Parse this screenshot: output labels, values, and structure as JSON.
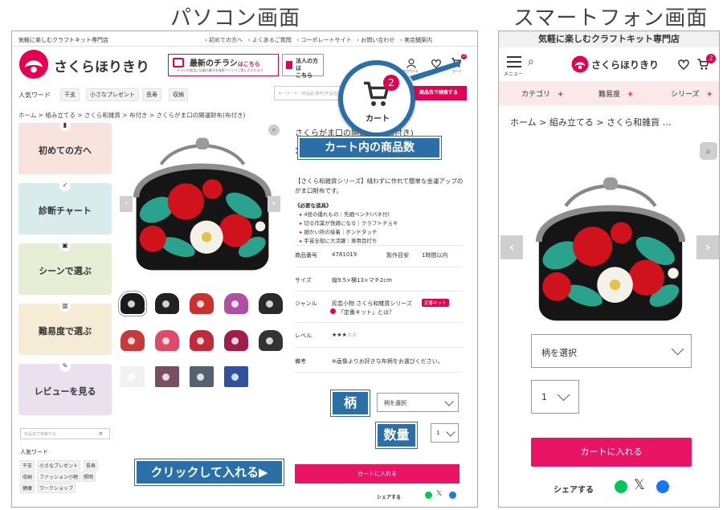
{
  "titles": {
    "pc": "パソコン画面",
    "sp": "スマートフォン画面"
  },
  "pc": {
    "topbar": {
      "tagline": "気軽に楽しむクラフトキット専門店",
      "links": [
        "初めての方へ",
        "よくあるご質問",
        "コーポレートサイト",
        "お問い合わせ",
        "実店舗案内"
      ]
    },
    "logo_text": "さくらほりきり",
    "flyer": {
      "title": "最新のチラシ",
      "suffix": "はこちら",
      "sub": "チラシの商品に記載の番号を検索ページでご覧いただけます"
    },
    "corp": {
      "line1": "法人の方は",
      "line2": "こちら"
    },
    "header_icons": {
      "account_label": "アカウント",
      "cart_label": "カート",
      "cart_count": "2"
    },
    "popular": {
      "label": "人気ワード",
      "tags": [
        "干支",
        "小さなプレゼント",
        "長寿",
        "収納"
      ]
    },
    "search": {
      "placeholder": "キーワード（商品名/番号/作品名）",
      "button": "商品名で検索する"
    },
    "breadcrumb": [
      "ホーム",
      "組み立てる",
      "さくら和雑貨",
      "布付き",
      "さくらがま口の開運財布(布付き)"
    ],
    "sidebar": [
      "初めての方へ",
      "診断チャート",
      "シーンで選ぶ",
      "難易度で選ぶ",
      "レビューを見る"
    ],
    "side_search_placeholder": "商品名で検索する",
    "side_popular": {
      "label": "人気ワード",
      "tags": [
        "干支",
        "小さなプレゼント",
        "長寿",
        "収納",
        "ファッション小物",
        "照明",
        "健康",
        "ワークショップ"
      ]
    },
    "product": {
      "name": "さくらがま口の開運財布(布付き)",
      "desc1": "【さくら和雑貨シリーズ】縫わずに作れて簡単な金運アップの",
      "desc2": "がま口財布です。",
      "tools_title": "《必要な道具》",
      "tools": [
        "4役の優れもの｜先細ペンチ(バネ付)",
        "切る作業が快適になる｜クラフトチョキ",
        "細かい所の接着｜ボンドタッチ",
        "手芸全般に大活躍｜専用目打ち"
      ],
      "rows": [
        {
          "k": "商品番号",
          "v": "4781019",
          "k2": "製作目安",
          "v2": "1時間以内"
        },
        {
          "k": "サイズ",
          "v": "縦9.5×横13×マチ2cm"
        },
        {
          "k": "ジャンル",
          "v": "民芸小物 さくら和雑貨シリーズ",
          "badge": "定番キット",
          "v3": "「定番キット」とは？"
        },
        {
          "k": "レベル",
          "v": "★★★☆☆"
        },
        {
          "k": "備考",
          "v": "※画像よりお好きな布柄をお選びください。"
        }
      ],
      "pattern_select": "柄を選択",
      "qty": "1",
      "cart_button": "カートに入れる",
      "share": "シェアする"
    },
    "callouts": {
      "cart_zoom_label": "カート",
      "cart_zoom_count": "2",
      "cart_items": "カート内の商品数",
      "pattern": "柄",
      "qty": "数量",
      "click": "クリックして入れる▶"
    }
  },
  "sp": {
    "tagline": "気軽に楽しむクラフトキット専門店",
    "menu_label": "メニュー",
    "logo_text": "さくらほりきり",
    "cart_count": "2",
    "tabs": [
      "カテゴリ",
      "難易度",
      "シリーズ"
    ],
    "breadcrumb": [
      "ホーム",
      "組み立てる",
      "さくら和雑貨 …"
    ],
    "pattern_select": "柄を選択",
    "qty": "1",
    "cart_button": "カートに入れる",
    "share": "シェアする"
  },
  "colors": {
    "accent": "#ea1464",
    "callout_blue": "#2a6fa8",
    "pink_tab": "#fbe9ea"
  }
}
